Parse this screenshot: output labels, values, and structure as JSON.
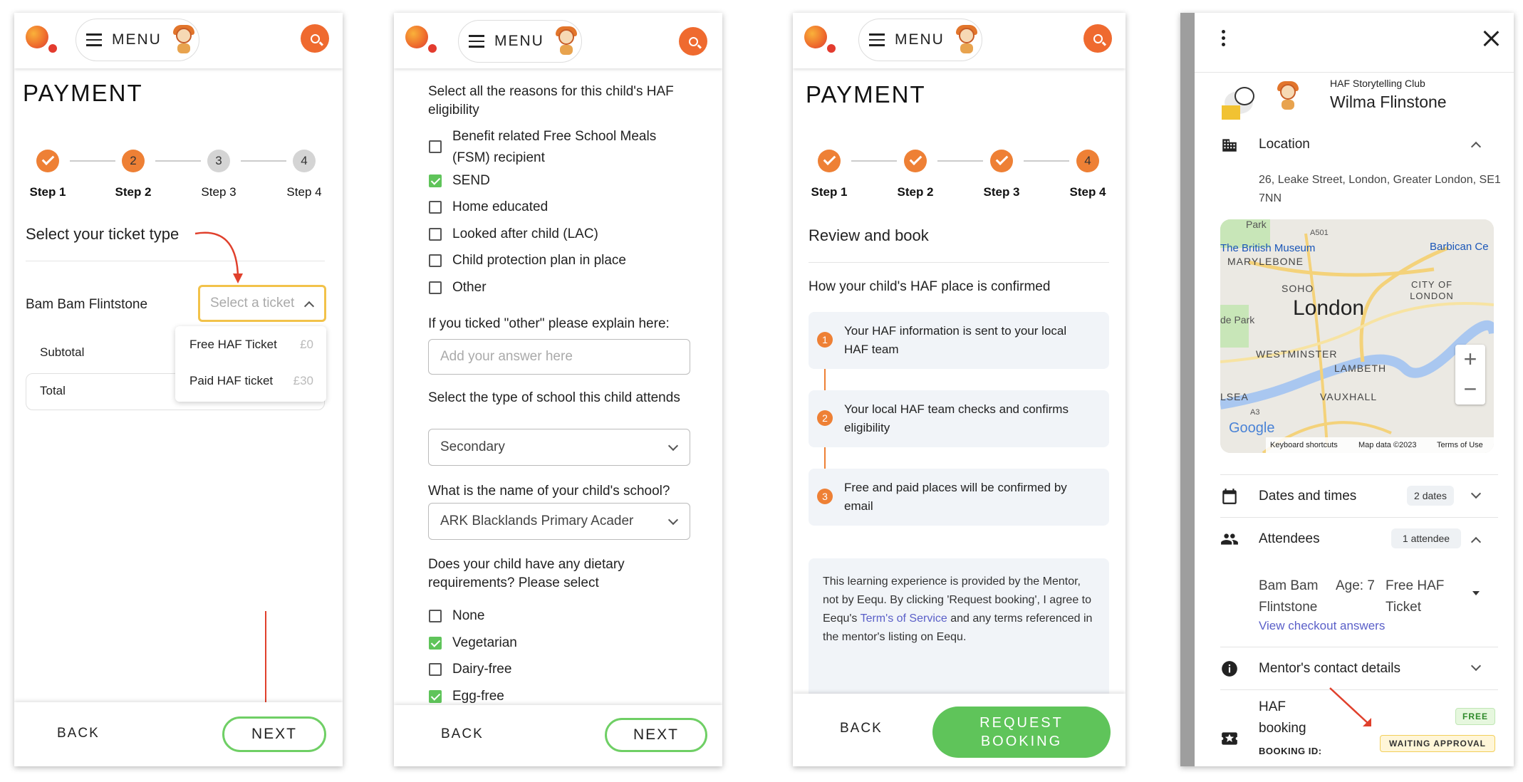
{
  "header": {
    "menu_label": "MENU"
  },
  "s1": {
    "title": "PAYMENT",
    "steps": [
      "Step 1",
      "Step 2",
      "Step 3",
      "Step 4"
    ],
    "step_nums": [
      "2",
      "3",
      "4"
    ],
    "section": "Select your ticket type",
    "child": "Bam Bam Flintstone",
    "select_placeholder": "Select a ticket",
    "options": [
      {
        "label": "Free HAF Ticket",
        "price": "£0"
      },
      {
        "label": "Paid HAF ticket",
        "price": "£30"
      }
    ],
    "subtotal": "Subtotal",
    "total": "Total",
    "back": "BACK",
    "next": "NEXT"
  },
  "s2": {
    "q1": "Select all the reasons for this child's HAF eligibility",
    "reasons": [
      {
        "label": "Benefit related Free School Meals (FSM) recipient",
        "checked": false
      },
      {
        "label": "SEND",
        "checked": true
      },
      {
        "label": "Home educated",
        "checked": false
      },
      {
        "label": "Looked after child (LAC)",
        "checked": false
      },
      {
        "label": "Child protection plan in place",
        "checked": false
      },
      {
        "label": "Other",
        "checked": false
      }
    ],
    "q2": "If you ticked \"other\" please explain here:",
    "q2_placeholder": "Add your answer here",
    "q3": "Select the type of school this child attends",
    "school_type": "Secondary",
    "q4": "What is the name of your child's school?",
    "school_name": "ARK Blacklands Primary Acader",
    "q5": "Does your child have any dietary requirements? Please select",
    "diet": [
      {
        "label": "None",
        "checked": false
      },
      {
        "label": "Vegetarian",
        "checked": true
      },
      {
        "label": "Dairy-free",
        "checked": false
      },
      {
        "label": "Egg-free",
        "checked": true
      }
    ],
    "back": "BACK",
    "next": "NEXT"
  },
  "s3": {
    "title": "PAYMENT",
    "steps": [
      "Step 1",
      "Step 2",
      "Step 3",
      "Step 4"
    ],
    "step4": "4",
    "section": "Review and book",
    "how": "How your child's HAF place is confirmed",
    "items": [
      {
        "n": "1",
        "text": "Your HAF information is sent to your local HAF team"
      },
      {
        "n": "2",
        "text": "Your local HAF team checks and confirms eligibility"
      },
      {
        "n": "3",
        "text": "Free and paid places will be confirmed by email"
      }
    ],
    "terms_1": "This learning experience is provided by the Mentor, not by Eequ. By clicking 'Request booking', I agree to Eequ's ",
    "terms_link": "Term's of Service",
    "terms_2": " and any terms referenced in the mentor's listing on Eequ.",
    "back": "BACK",
    "request": "REQUEST BOOKING"
  },
  "s4": {
    "club": "HAF Storytelling Club",
    "name": "Wilma Flinstone",
    "location_label": "Location",
    "address": "26, Leake Street, London, Greater London, SE1 7NN",
    "map": {
      "city": "London",
      "labels": [
        "Park",
        "The British Museum",
        "Barbican Ce",
        "MARYLEBONE",
        "SOHO",
        "CITY OF LONDON",
        "de Park",
        "WESTMINSTER",
        "LAMBETH",
        "LSEA",
        "VAUXHALL",
        "A501",
        "A3"
      ],
      "footer": [
        "Keyboard shortcuts",
        "Map data ©2023",
        "Terms of Use"
      ],
      "google": "Google",
      "zoom_in": "+",
      "zoom_out": "−"
    },
    "dates_label": "Dates and times",
    "dates_badge": "2 dates",
    "attendees_label": "Attendees",
    "attendees_badge": "1 attendee",
    "attendee": {
      "name": "Bam Bam Flintstone",
      "age": "Age: 7",
      "ticket": "Free HAF Ticket"
    },
    "checkout_link": "View checkout answers",
    "mentor_label": "Mentor's contact details",
    "booking_title": "HAF booking",
    "booking_id": "BOOKING ID:",
    "free_tag": "FREE",
    "status_tag": "WAITING APPROVAL"
  },
  "colors": {
    "orange": "#ee8035",
    "green": "#5fc45a",
    "link": "#5a5fc8",
    "arrow": "#e0402c"
  }
}
